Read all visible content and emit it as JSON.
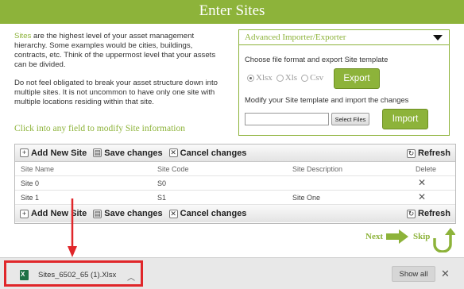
{
  "page_title": "Enter Sites",
  "intro": {
    "highlight": "Sites",
    "p1_rest": " are the highest level of your asset management hierarchy. Some examples would be cities, buildings, contracts, etc. Think of the uppermost level that your assets can be divided.",
    "p2": "Do not feel obligated to break your asset structure down into multiple sites. It is not uncommon to have only one site with multiple locations residing within that site.",
    "hint": "Click into any field to modify Site information"
  },
  "importer": {
    "title": "Advanced Importer/Exporter",
    "choose_label": "Choose file format and export Site template",
    "formats": [
      "Xlsx",
      "Xls",
      "Csv"
    ],
    "selected_format": "Xlsx",
    "export_label": "Export",
    "modify_label": "Modify your Site template and import the changes",
    "select_files_label": "Select Files",
    "import_label": "Import"
  },
  "grid": {
    "toolbar": {
      "add": "Add New Site",
      "save": "Save changes",
      "cancel": "Cancel changes",
      "refresh": "Refresh"
    },
    "columns": [
      "Site Name",
      "Site Code",
      "Site Description",
      "Delete"
    ],
    "rows": [
      {
        "name": "Site 0",
        "code": "S0",
        "description": ""
      },
      {
        "name": "Site 1",
        "code": "S1",
        "description": "Site One"
      }
    ]
  },
  "nav": {
    "next": "Next",
    "skip": "Skip"
  },
  "download_bar": {
    "file_name": "Sites_6502_65 (1).Xlsx",
    "show_all": "Show all"
  },
  "colors": {
    "accent": "#8db33a",
    "highlight_box": "#e0262a"
  }
}
